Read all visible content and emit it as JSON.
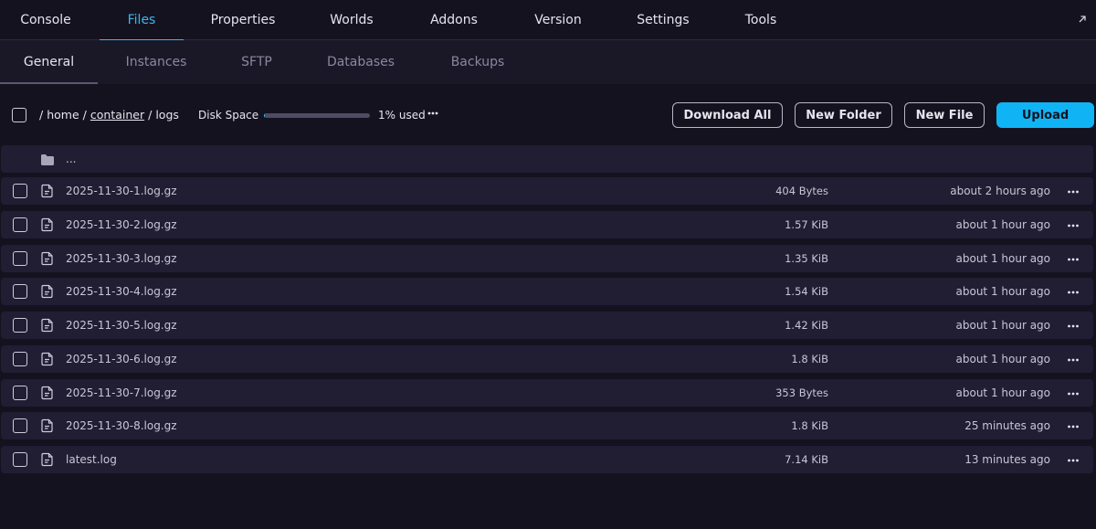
{
  "top_nav": {
    "tabs": [
      {
        "label": "Console"
      },
      {
        "label": "Files",
        "active": true
      },
      {
        "label": "Properties"
      },
      {
        "label": "Worlds"
      },
      {
        "label": "Addons"
      },
      {
        "label": "Version"
      },
      {
        "label": "Settings"
      },
      {
        "label": "Tools"
      }
    ],
    "expand_icon": "arrow-up-right-icon"
  },
  "sub_nav": {
    "tabs": [
      {
        "label": "General",
        "active": true
      },
      {
        "label": "Instances"
      },
      {
        "label": "SFTP"
      },
      {
        "label": "Databases"
      },
      {
        "label": "Backups"
      }
    ]
  },
  "toolbar": {
    "breadcrumb": {
      "sep_root": "/",
      "home": "home",
      "sep1": "/",
      "container": "container",
      "sep2": "/",
      "logs": "logs"
    },
    "disk_space": {
      "label": "Disk Space",
      "used_percent": 1,
      "used_text": "1% used"
    },
    "buttons": {
      "download_all": "Download All",
      "new_folder": "New Folder",
      "new_file": "New File",
      "upload": "Upload"
    }
  },
  "parent_dir": {
    "name": "..."
  },
  "files": [
    {
      "name": "2025-11-30-1.log.gz",
      "size": "404 Bytes",
      "modified": "about 2 hours ago"
    },
    {
      "name": "2025-11-30-2.log.gz",
      "size": "1.57 KiB",
      "modified": "about 1 hour ago"
    },
    {
      "name": "2025-11-30-3.log.gz",
      "size": "1.35 KiB",
      "modified": "about 1 hour ago"
    },
    {
      "name": "2025-11-30-4.log.gz",
      "size": "1.54 KiB",
      "modified": "about 1 hour ago"
    },
    {
      "name": "2025-11-30-5.log.gz",
      "size": "1.42 KiB",
      "modified": "about 1 hour ago"
    },
    {
      "name": "2025-11-30-6.log.gz",
      "size": "1.8 KiB",
      "modified": "about 1 hour ago"
    },
    {
      "name": "2025-11-30-7.log.gz",
      "size": "353 Bytes",
      "modified": "about 1 hour ago"
    },
    {
      "name": "2025-11-30-8.log.gz",
      "size": "1.8 KiB",
      "modified": "25 minutes ago"
    },
    {
      "name": "latest.log",
      "size": "7.14 KiB",
      "modified": "13 minutes ago"
    }
  ],
  "colors": {
    "accent": "#35b8f2",
    "upload_button": "#10b4f5",
    "background": "#15121f",
    "row_background": "#211d33"
  }
}
